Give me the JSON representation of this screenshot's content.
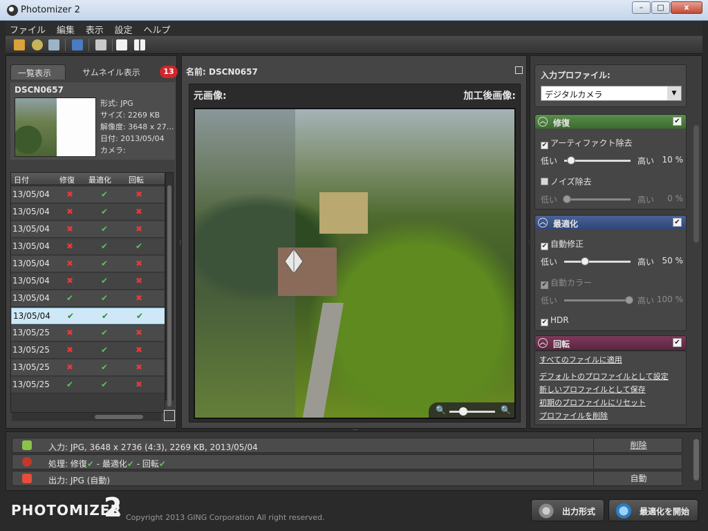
{
  "window": {
    "title": "Photomizer 2",
    "min": "–",
    "max": "□",
    "close": "x"
  },
  "menu": [
    "ファイル",
    "編集",
    "表示",
    "設定",
    "ヘルプ"
  ],
  "left": {
    "tab_list": "一覧表示",
    "tab_thumbs": "サムネイル表示",
    "badge": "13",
    "file_name": "DSCN0657",
    "meta": [
      "形式: JPG",
      "サイズ: 2269 KB",
      "解像度: 3648 x 27…",
      "日付: 2013/05/04",
      "カメラ:"
    ],
    "headers": {
      "date": "日付",
      "fix": "修復",
      "opt": "最適化",
      "rot": "回転"
    },
    "rows": [
      {
        "date": "13/05/04",
        "fix": "✖",
        "opt": "✔",
        "rot": "✖"
      },
      {
        "date": "13/05/04",
        "fix": "✖",
        "opt": "✔",
        "rot": "✖"
      },
      {
        "date": "13/05/04",
        "fix": "✖",
        "opt": "✔",
        "rot": "✖"
      },
      {
        "date": "13/05/04",
        "fix": "✖",
        "opt": "✔",
        "rot": "✔"
      },
      {
        "date": "13/05/04",
        "fix": "✖",
        "opt": "✔",
        "rot": "✖"
      },
      {
        "date": "13/05/04",
        "fix": "✖",
        "opt": "✔",
        "rot": "✖"
      },
      {
        "date": "13/05/04",
        "fix": "✔",
        "opt": "✔",
        "rot": "✖"
      },
      {
        "date": "13/05/04",
        "fix": "✔",
        "opt": "✔",
        "rot": "✔"
      },
      {
        "date": "13/05/25",
        "fix": "✖",
        "opt": "✔",
        "rot": "✖"
      },
      {
        "date": "13/05/25",
        "fix": "✖",
        "opt": "✔",
        "rot": "✖"
      },
      {
        "date": "13/05/25",
        "fix": "✖",
        "opt": "✔",
        "rot": "✖"
      },
      {
        "date": "13/05/25",
        "fix": "✔",
        "opt": "✔",
        "rot": "✖"
      }
    ]
  },
  "center": {
    "name_label": "名前: DSCN0657",
    "original_label": "元画像:",
    "processed_label": "加工後画像:",
    "zoom_level": 0.3
  },
  "right": {
    "profile_label": "入力プロファイル:",
    "profile_value": "デジタルカメラ",
    "repair": {
      "title": "修復",
      "artifact": "アーティファクト除去",
      "noise": "ノイズ除去",
      "low": "低い",
      "high": "高い",
      "artifact_value": "10 %",
      "noise_value": "0 %"
    },
    "optimize": {
      "title": "最適化",
      "auto_fix": "自動修正",
      "auto_color": "自動カラー",
      "hdr": "HDR",
      "low": "低い",
      "high": "高い",
      "fix_value": "50 %",
      "color_value": "100 %"
    },
    "rotate": {
      "title": "回転"
    },
    "links": [
      "すべてのファイルに適用",
      "デフォルトのプロファイルとして設定",
      "新しいプロファイルとして保存",
      "初期のプロファイルにリセット",
      "プロファイルを削除"
    ]
  },
  "info": {
    "input": "入力: JPG, 3648 x 2736 (4:3), 2269 KB, 2013/05/04",
    "input_action": "削除",
    "process_prefix": "処理: 修復",
    "process_opt": " - 最適化",
    "process_rot": " - 回転",
    "check": "✔",
    "output": "出力: JPG (自動)",
    "output_action": "自動"
  },
  "footer": {
    "logo": "PHOTOMIZER",
    "logo_num": "2",
    "copyright": "Copyright 2013 GING Corporation All right reserved.",
    "output_btn": "出力形式",
    "start_btn": "最適化を開始"
  }
}
